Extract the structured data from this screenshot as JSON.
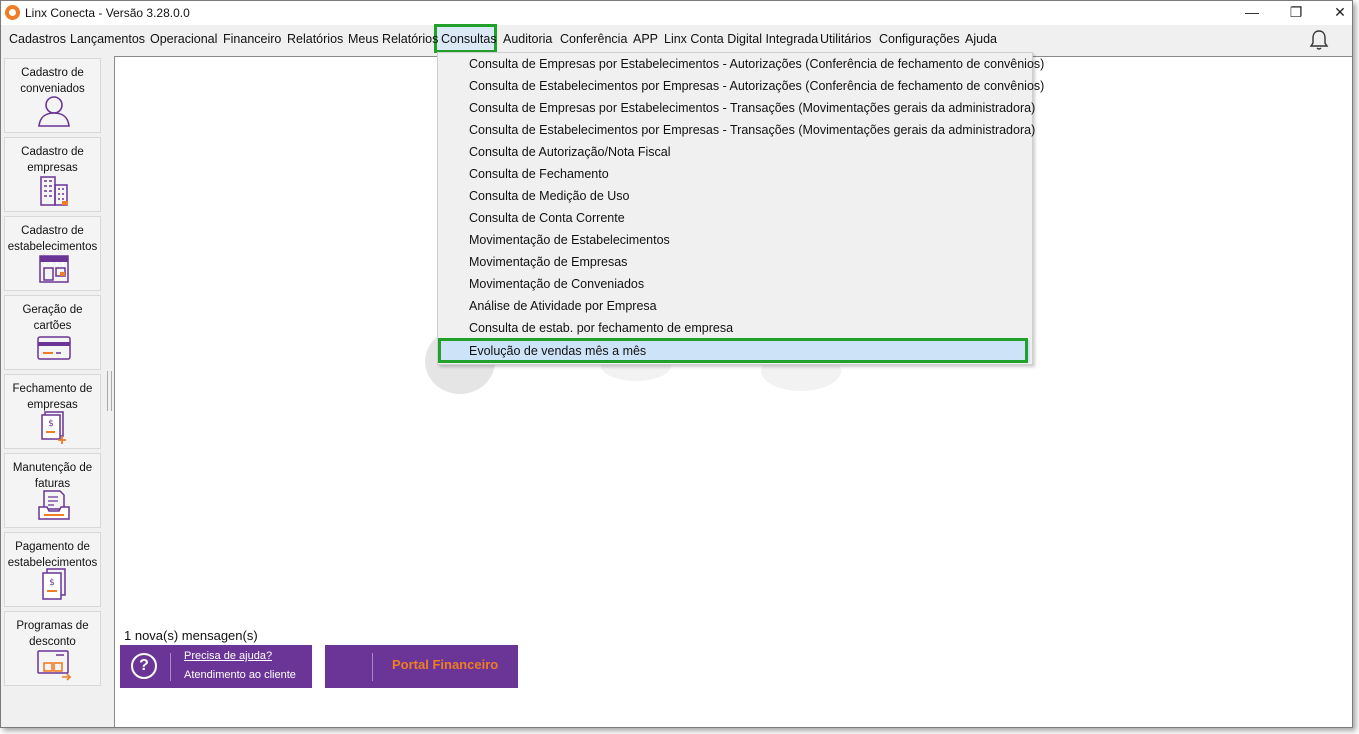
{
  "window": {
    "title": "Linx Conecta - Versão 3.28.0.0",
    "controls": [
      "—",
      "❐",
      "✕"
    ]
  },
  "menubar": {
    "items": [
      "Cadastros",
      "Lançamentos",
      "Operacional",
      "Financeiro",
      "Relatórios",
      "Meus Relatórios",
      "Consultas",
      "Auditoria",
      "Conferência",
      "APP",
      "Linx Conta Digital Integrada",
      "Utilitários",
      "Configurações",
      "Ajuda"
    ],
    "active_item": "Consultas",
    "notification_icon": "bell-icon"
  },
  "sidebar": {
    "items": [
      {
        "label": "Cadastro de conveniados",
        "icon": "user-icon"
      },
      {
        "label": "Cadastro de empresas",
        "icon": "building-icon"
      },
      {
        "label": "Cadastro de estabelecimentos",
        "icon": "store-icon"
      },
      {
        "label": "Geração de cartões",
        "icon": "card-icon"
      },
      {
        "label": "Fechamento de empresas",
        "icon": "closing-document-icon"
      },
      {
        "label": "Manutenção de faturas",
        "icon": "invoice-tray-icon"
      },
      {
        "label": "Pagamento de estabelecimentos",
        "icon": "payment-document-icon"
      },
      {
        "label": "Programas de desconto",
        "icon": "discount-card-icon"
      }
    ]
  },
  "consultas_menu": {
    "items": [
      "Consulta de Empresas por Estabelecimentos - Autorizações (Conferência de fechamento de convênios)",
      "Consulta de Estabelecimentos por Empresas - Autorizações (Conferência de fechamento de convênios)",
      "Consulta de Empresas por Estabelecimentos - Transações (Movimentações gerais da administradora)",
      "Consulta de Estabelecimentos por Empresas - Transações (Movimentações gerais da administradora)",
      "Consulta de Autorização/Nota Fiscal",
      "Consulta de Fechamento",
      "Consulta de Medição de Uso",
      "Consulta de Conta Corrente",
      "Movimentação de Estabelecimentos",
      "Movimentação de Empresas",
      "Movimentação de Conveniados",
      "Análise de Atividade por Empresa",
      "Consulta de estab. por fechamento de empresa",
      "Evolução de vendas mês a mês"
    ],
    "highlighted_item": "Evolução de vendas mês a mês"
  },
  "footer": {
    "messages": "1 nova(s) mensagen(s)",
    "help_link": "Precisa de ajuda?",
    "help_sub": "Atendimento ao cliente",
    "portal_label": "Portal Financeiro"
  },
  "colors": {
    "brand_purple": "#6a3596",
    "brand_orange": "#f07c24",
    "highlight_green": "#21a02a",
    "selection_blue": "#cde3f7"
  }
}
